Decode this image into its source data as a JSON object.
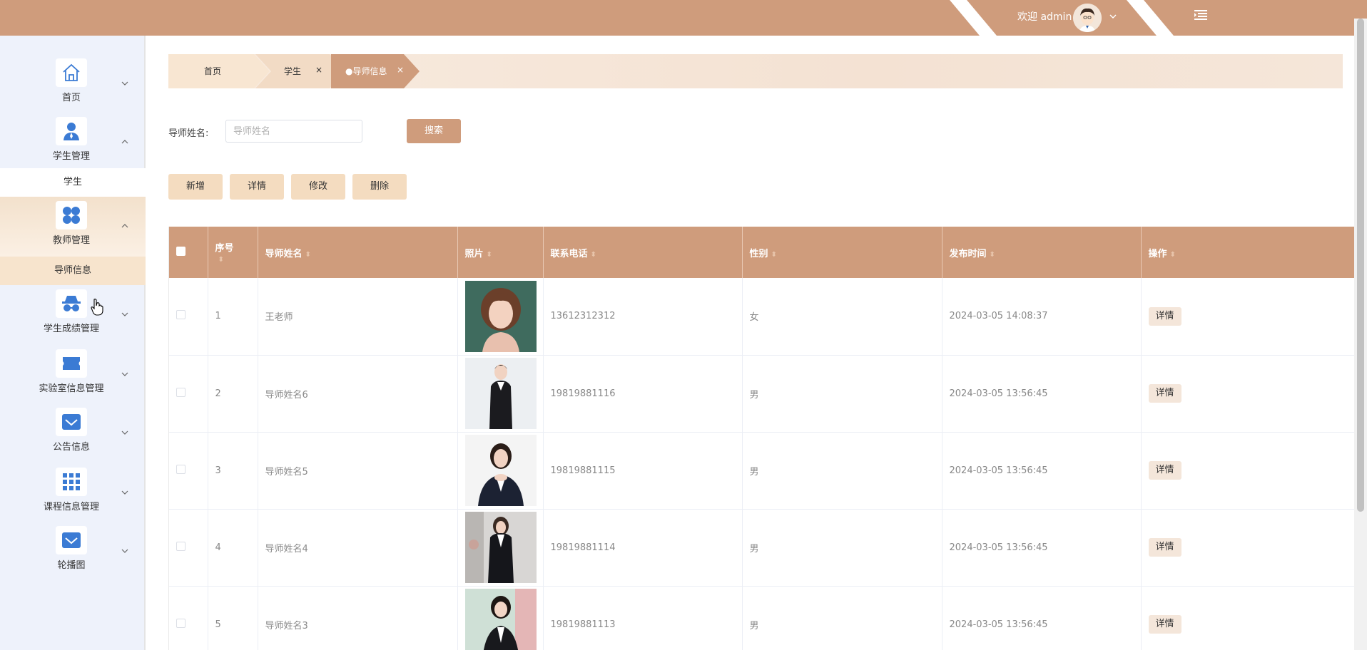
{
  "header": {
    "welcome": "欢迎 admin",
    "color": "#cf9c7c"
  },
  "sidebar": {
    "items": [
      {
        "label": "首页",
        "icon": "home-icon"
      },
      {
        "label": "学生管理",
        "icon": "user-icon",
        "sub": [
          "学生"
        ]
      },
      {
        "label": "教师管理",
        "icon": "apps-icon",
        "sub": [
          "导师信息"
        ]
      },
      {
        "label": "学生成绩管理",
        "icon": "spy-icon"
      },
      {
        "label": "实验室信息管理",
        "icon": "ticket-icon"
      },
      {
        "label": "公告信息",
        "icon": "mail-icon"
      },
      {
        "label": "课程信息管理",
        "icon": "grid-icon"
      },
      {
        "label": "轮播图",
        "icon": "mail-icon"
      }
    ]
  },
  "tags": [
    "首页",
    "学生",
    "●导师信息"
  ],
  "search": {
    "label": "导师姓名:",
    "placeholder": "导师姓名",
    "button": "搜索"
  },
  "toolbar": {
    "add": "新增",
    "detail": "详情",
    "edit": "修改",
    "delete": "删除"
  },
  "table": {
    "headers": [
      "序号",
      "导师姓名",
      "照片",
      "联系电话",
      "性别",
      "发布时间",
      "操作"
    ],
    "action_label": "详情",
    "rows": [
      {
        "no": "1",
        "name": "王老师",
        "phone": "13612312312",
        "gender": "女",
        "time": "2024-03-05 14:08:37"
      },
      {
        "no": "2",
        "name": "导师姓名6",
        "phone": "19819881116",
        "gender": "男",
        "time": "2024-03-05 13:56:45"
      },
      {
        "no": "3",
        "name": "导师姓名5",
        "phone": "19819881115",
        "gender": "男",
        "time": "2024-03-05 13:56:45"
      },
      {
        "no": "4",
        "name": "导师姓名4",
        "phone": "19819881114",
        "gender": "男",
        "time": "2024-03-05 13:56:45"
      },
      {
        "no": "5",
        "name": "导师姓名3",
        "phone": "19819881113",
        "gender": "男",
        "time": "2024-03-05 13:56:45"
      }
    ]
  }
}
